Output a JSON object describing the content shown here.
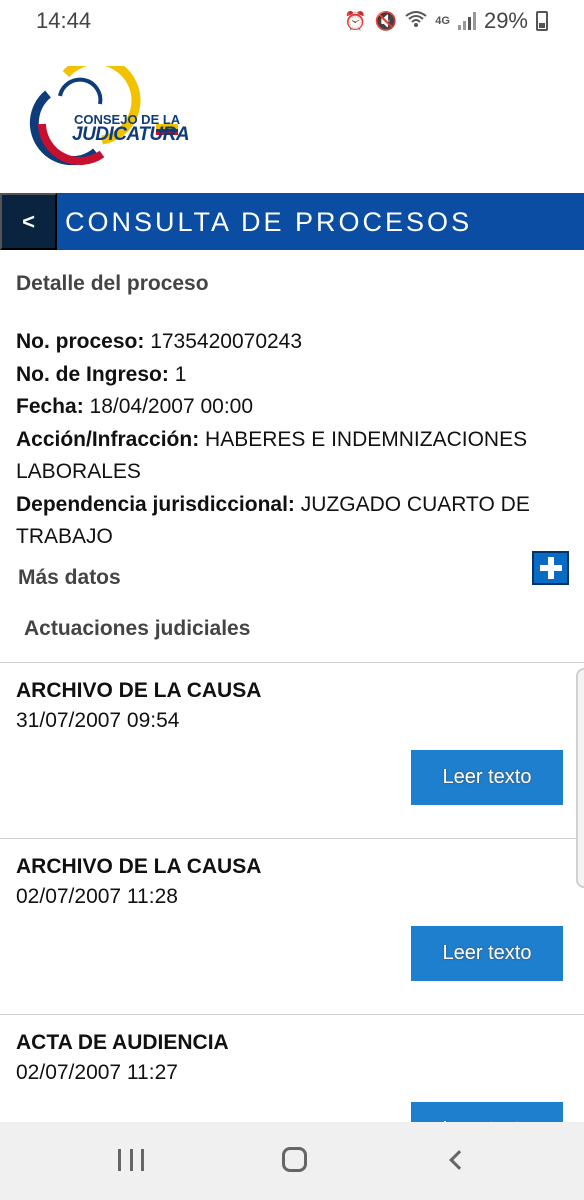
{
  "status_bar": {
    "time": "14:44",
    "network": "4G",
    "battery": "29%"
  },
  "logo": {
    "line1": "CONSEJO DE LA",
    "line2": "JUDICATURA",
    "colors": {
      "blue": "#0e3c7a",
      "yellow": "#f2c200",
      "red": "#c8102e"
    }
  },
  "header": {
    "back_label": "<",
    "title": "CONSULTA DE PROCESOS",
    "color": "#0a4da2"
  },
  "detail": {
    "section_title": "Detalle del proceso",
    "fields": [
      {
        "label": "No. proceso:",
        "value": "1735420070243"
      },
      {
        "label": "No. de Ingreso:",
        "value": "1"
      },
      {
        "label": "Fecha:",
        "value": "18/04/2007 00:00"
      },
      {
        "label": "Acción/Infracción:",
        "value": "HABERES E INDEMNIZACIONES LABORALES"
      },
      {
        "label": "Dependencia jurisdiccional:",
        "value": "JUZGADO CUARTO DE TRABAJO"
      }
    ],
    "more_label": "Más datos"
  },
  "actuaciones": {
    "title": "Actuaciones judiciales",
    "button_label": "Leer texto",
    "items": [
      {
        "title": "ARCHIVO DE LA CAUSA",
        "date": "31/07/2007 09:54"
      },
      {
        "title": "ARCHIVO DE LA CAUSA",
        "date": "02/07/2007 11:28"
      },
      {
        "title": "ACTA DE AUDIENCIA",
        "date": "02/07/2007 11:27"
      }
    ]
  },
  "nav_icons": [
    "recent-apps-icon",
    "home-icon",
    "back-icon"
  ]
}
